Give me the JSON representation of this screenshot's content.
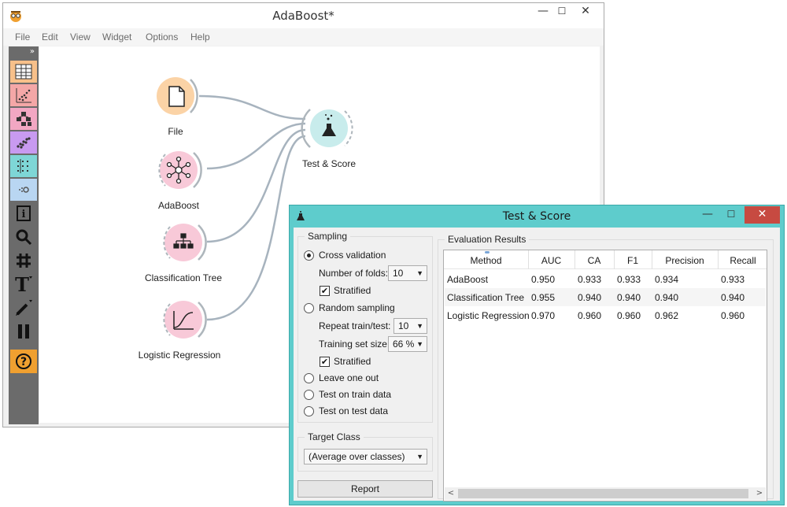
{
  "main_window": {
    "title": "AdaBoost*",
    "controls": {
      "minimize": "—",
      "maximize": "☐",
      "close": "✕"
    },
    "menu": [
      "File",
      "Edit",
      "View",
      "Widget",
      "Options",
      "Help"
    ],
    "toolbox_toggle": "»",
    "toolbox": [
      {
        "icon": "data-table-icon",
        "color": "#f7c08a"
      },
      {
        "icon": "scatter-plot-icon",
        "color": "#f4a7a7"
      },
      {
        "icon": "hierarchy-icon",
        "color": "#f2a7c3"
      },
      {
        "icon": "scatter-dots-icon",
        "color": "#c89af0"
      },
      {
        "icon": "matrix-icon",
        "color": "#7ed6d6"
      },
      {
        "icon": "gear-dots-icon",
        "color": "#b9d6f2"
      },
      {
        "icon": "info-icon",
        "color": "#6b6b6b"
      },
      {
        "icon": "zoom-icon",
        "color": "#6b6b6b"
      },
      {
        "icon": "hash-icon",
        "color": "#6b6b6b"
      },
      {
        "icon": "text-icon",
        "color": "#6b6b6b"
      },
      {
        "icon": "pen-icon",
        "color": "#6b6b6b"
      },
      {
        "icon": "pause-icon",
        "color": "#6b6b6b"
      },
      {
        "icon": "help-icon",
        "color": "#f0a030"
      }
    ]
  },
  "canvas": {
    "nodes": [
      {
        "label": "File",
        "icon": "file-icon",
        "color": "#fbd3a6"
      },
      {
        "label": "AdaBoost",
        "icon": "network-icon",
        "color": "#f8c9d8"
      },
      {
        "label": "Classification Tree",
        "icon": "tree-icon",
        "color": "#f8c9d8"
      },
      {
        "label": "Logistic Regression",
        "icon": "sigmoid-icon",
        "color": "#f8c9d8"
      },
      {
        "label": "Test & Score",
        "icon": "flask-icon",
        "color": "#c8ecec"
      }
    ]
  },
  "test_score": {
    "title": "Test & Score",
    "controls": {
      "minimize": "—",
      "maximize": "☐",
      "close": "✕"
    },
    "sampling": {
      "title": "Sampling",
      "cross_validation": "Cross validation",
      "folds_label": "Number of folds:",
      "folds_value": "10",
      "stratified": "Stratified",
      "random_sampling": "Random sampling",
      "repeat_label": "Repeat train/test:",
      "repeat_value": "10",
      "train_size_label": "Training set size:",
      "train_size_value": "66 %",
      "stratified2": "Stratified",
      "leave_one_out": "Leave one out",
      "test_on_train": "Test on train data",
      "test_on_test": "Test on test data"
    },
    "target_class": {
      "title": "Target Class",
      "value": "(Average over classes)"
    },
    "report_button": "Report",
    "results": {
      "title": "Evaluation Results",
      "columns": [
        "Method",
        "AUC",
        "CA",
        "F1",
        "Precision",
        "Recall"
      ],
      "rows": [
        [
          "AdaBoost",
          "0.950",
          "0.933",
          "0.933",
          "0.934",
          "0.933"
        ],
        [
          "Classification Tree",
          "0.955",
          "0.940",
          "0.940",
          "0.940",
          "0.940"
        ],
        [
          "Logistic Regression",
          "0.970",
          "0.960",
          "0.960",
          "0.962",
          "0.960"
        ]
      ],
      "scroll_left": "<",
      "scroll_right": ">"
    }
  }
}
